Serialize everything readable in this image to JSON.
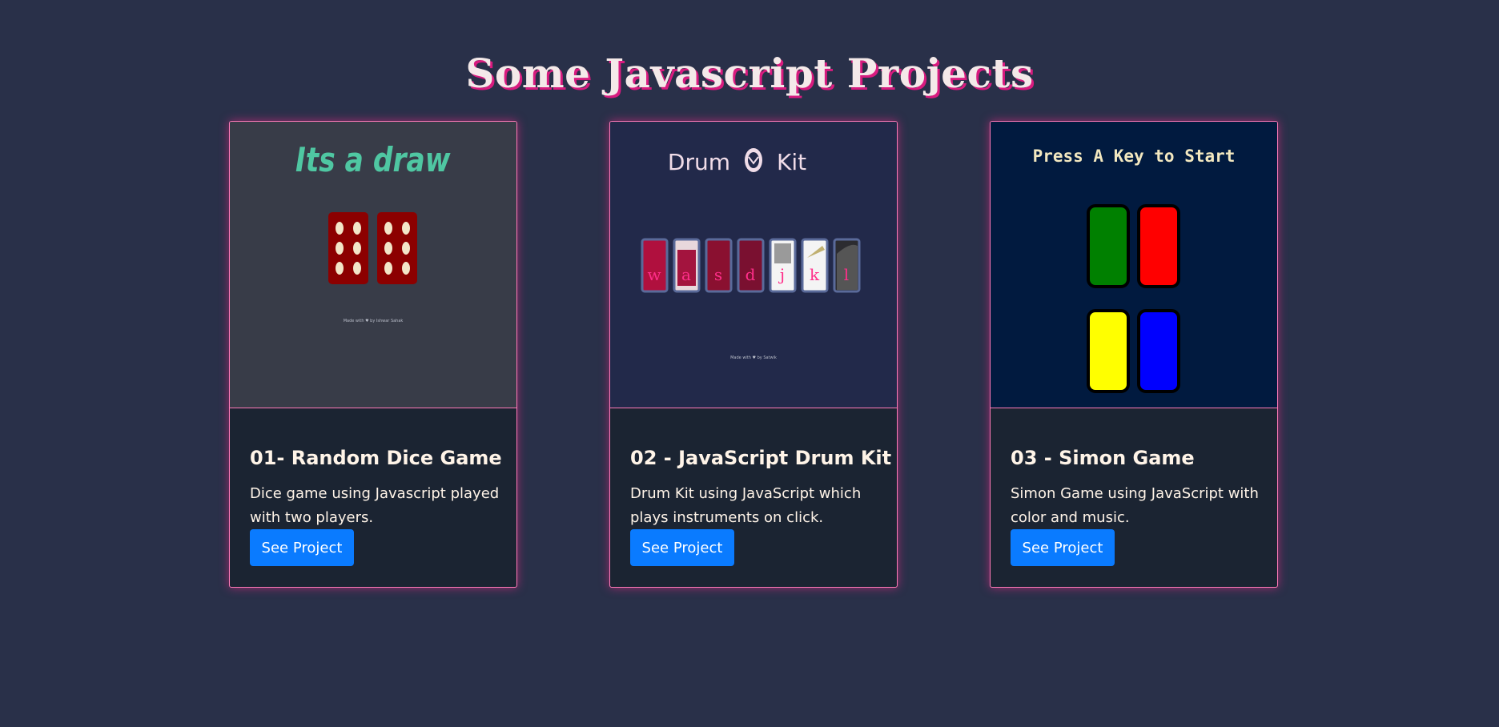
{
  "page": {
    "title": "Some Javascript Projects",
    "background": "#293049",
    "accent": "#d81b7f"
  },
  "projects": [
    {
      "title": "01- Random Dice Game",
      "description": "Dice game using Javascript played with two players.",
      "button_label": "See Project",
      "thumbnail": {
        "heading": "Its a draw",
        "footer": "Made with ♥ by Ishwar Sahak",
        "background": "#383c48"
      }
    },
    {
      "title": "02 - JavaScript Drum Kit",
      "description": "Drum Kit using JavaScript which plays instruments on click.",
      "button_label": "See Project",
      "thumbnail": {
        "heading_left": "Drum",
        "heading_right": "Kit",
        "keys": [
          "w",
          "a",
          "s",
          "d",
          "j",
          "k",
          "l"
        ],
        "footer": "Made with ♥ by Satwik",
        "background": "#22294a"
      }
    },
    {
      "title": "03 - Simon Game",
      "description": "Simon Game using JavaScript with color and music.",
      "button_label": "See Project",
      "thumbnail": {
        "heading": "Press A Key to Start",
        "background": "#011a3f",
        "button_colors": [
          "#008000",
          "#ff0000",
          "#ffff00",
          "#0000ff"
        ]
      }
    }
  ],
  "button_color": "#0a7bff"
}
